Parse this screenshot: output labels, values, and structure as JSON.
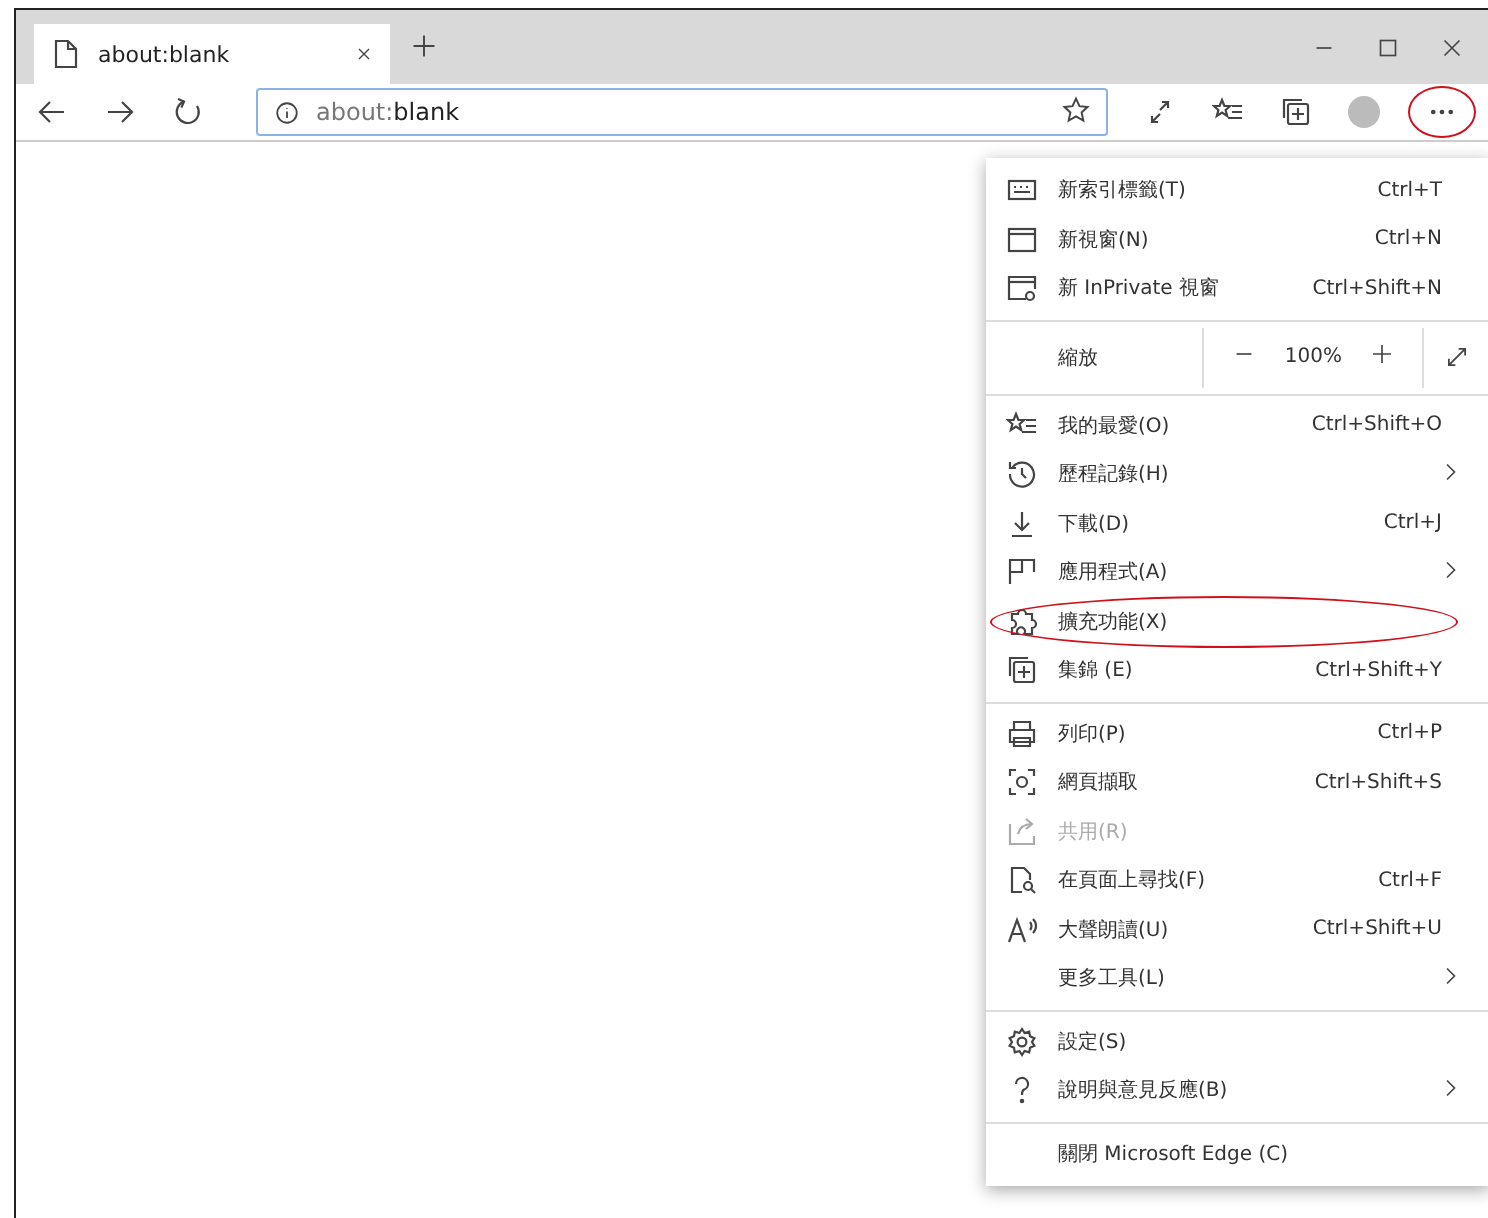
{
  "tabs": [
    {
      "title": "about:blank",
      "selected": true
    }
  ],
  "address_bar": {
    "scheme": "about:",
    "rest": "blank"
  },
  "more_button": {
    "circled": true
  },
  "menu": {
    "sections": [
      [
        {
          "kind": "item",
          "label": "新索引標籤(T)",
          "shortcut": "Ctrl+T",
          "submenu": false,
          "disabled": false,
          "circled": false
        },
        {
          "kind": "item",
          "label": "新視窗(N)",
          "shortcut": "Ctrl+N",
          "submenu": false,
          "disabled": false,
          "circled": false
        },
        {
          "kind": "item",
          "label": "新 InPrivate 視窗",
          "shortcut": "Ctrl+Shift+N",
          "submenu": false,
          "disabled": false,
          "circled": false
        }
      ],
      [
        {
          "kind": "zoom",
          "label": "縮放",
          "value": "100%"
        }
      ],
      [
        {
          "kind": "item",
          "label": "我的最愛(O)",
          "shortcut": "Ctrl+Shift+O",
          "submenu": false,
          "disabled": false,
          "circled": false
        },
        {
          "kind": "item",
          "label": "歷程記錄(H)",
          "submenu": true,
          "disabled": false,
          "circled": false
        },
        {
          "kind": "item",
          "label": "下載(D)",
          "shortcut": "Ctrl+J",
          "submenu": false,
          "disabled": false,
          "circled": false
        },
        {
          "kind": "item",
          "label": "應用程式(A)",
          "submenu": true,
          "disabled": false,
          "circled": false
        },
        {
          "kind": "item",
          "label": "擴充功能(X)",
          "submenu": false,
          "disabled": false,
          "circled": true
        },
        {
          "kind": "item",
          "label": "集錦 (E)",
          "shortcut": "Ctrl+Shift+Y",
          "submenu": false,
          "disabled": false,
          "circled": false
        }
      ],
      [
        {
          "kind": "item",
          "label": "列印(P)",
          "shortcut": "Ctrl+P",
          "submenu": false,
          "disabled": false,
          "circled": false
        },
        {
          "kind": "item",
          "label": "網頁擷取",
          "shortcut": "Ctrl+Shift+S",
          "submenu": false,
          "disabled": false,
          "circled": false
        },
        {
          "kind": "item",
          "label": "共用(R)",
          "submenu": false,
          "disabled": true,
          "circled": false
        },
        {
          "kind": "item",
          "label": "在頁面上尋找(F)",
          "shortcut": "Ctrl+F",
          "submenu": false,
          "disabled": false,
          "circled": false
        },
        {
          "kind": "item",
          "label": "大聲朗讀(U)",
          "shortcut": "Ctrl+Shift+U",
          "submenu": false,
          "disabled": false,
          "circled": false
        },
        {
          "kind": "item",
          "label": "更多工具(L)",
          "submenu": true,
          "disabled": false,
          "circled": false
        }
      ],
      [
        {
          "kind": "item",
          "label": "設定(S)",
          "submenu": false,
          "disabled": false,
          "circled": false
        },
        {
          "kind": "item",
          "label": "說明與意見反應(B)",
          "submenu": true,
          "disabled": false,
          "circled": false
        }
      ],
      [
        {
          "kind": "item",
          "label": "關閉 Microsoft Edge (C)",
          "submenu": false,
          "disabled": false,
          "circled": false
        }
      ]
    ]
  }
}
